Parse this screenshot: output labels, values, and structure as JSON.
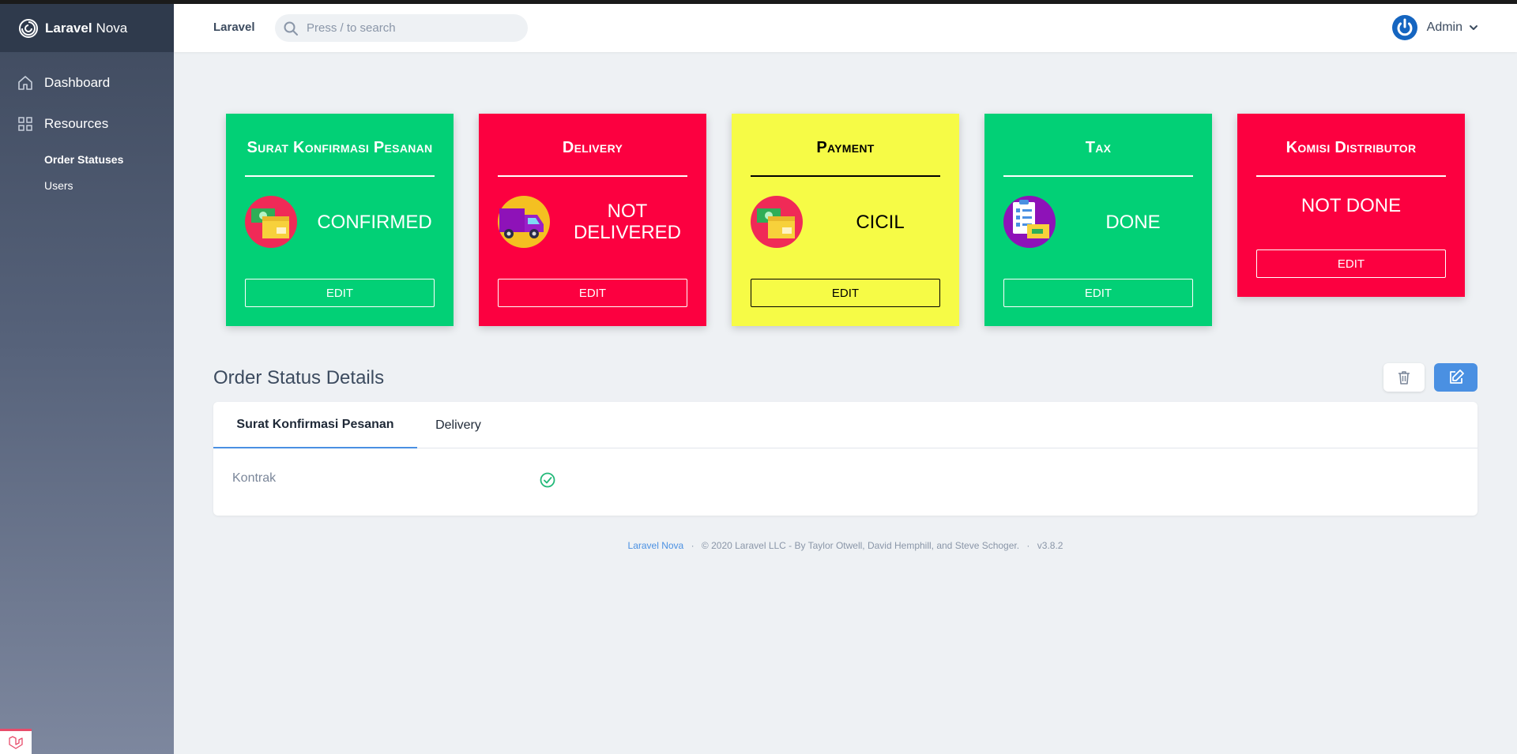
{
  "brand": {
    "name_bold": "Laravel",
    "name_regular": "Nova"
  },
  "sidebar": {
    "dashboard_label": "Dashboard",
    "resources_label": "Resources",
    "items": [
      {
        "label": "Order Statuses"
      },
      {
        "label": "Users"
      }
    ]
  },
  "header": {
    "app_name": "Laravel",
    "search_placeholder": "Press / to search",
    "user_name": "Admin"
  },
  "cards": [
    {
      "title": "Surat Konfirmasi Pesanan",
      "status": "CONFIRMED",
      "button_label": "EDIT",
      "bg": "#02d076",
      "fg": "#ffffff",
      "icon": "money-box-icon"
    },
    {
      "title": "Delivery",
      "status": "NOT DELIVERED",
      "button_label": "EDIT",
      "bg": "#fc0040",
      "fg": "#ffffff",
      "icon": "delivery-truck-icon"
    },
    {
      "title": "Payment",
      "status": "CICIL",
      "button_label": "EDIT",
      "bg": "#f6fb46",
      "fg": "#000000",
      "icon": "money-box-icon"
    },
    {
      "title": "Tax",
      "status": "DONE",
      "button_label": "EDIT",
      "bg": "#02d076",
      "fg": "#ffffff",
      "icon": "tax-document-icon"
    },
    {
      "title": "Komisi Distributor",
      "status": "NOT DONE",
      "button_label": "EDIT",
      "bg": "#fc0040",
      "fg": "#ffffff",
      "icon": ""
    }
  ],
  "details": {
    "title": "Order Status Details",
    "tabs": [
      {
        "label": "Surat Konfirmasi Pesanan",
        "active": true
      },
      {
        "label": "Delivery",
        "active": false
      }
    ],
    "field_label": "Kontrak",
    "field_value_icon": "check-circle-icon"
  },
  "footer": {
    "link_text": "Laravel Nova",
    "sep": "·",
    "copyright": "© 2020 Laravel LLC - By Taylor Otwell, David Hemphill, and Steve Schoger.",
    "version": "v3.8.2"
  },
  "colors": {
    "accent": "#4a90e2",
    "success": "#21b978"
  }
}
